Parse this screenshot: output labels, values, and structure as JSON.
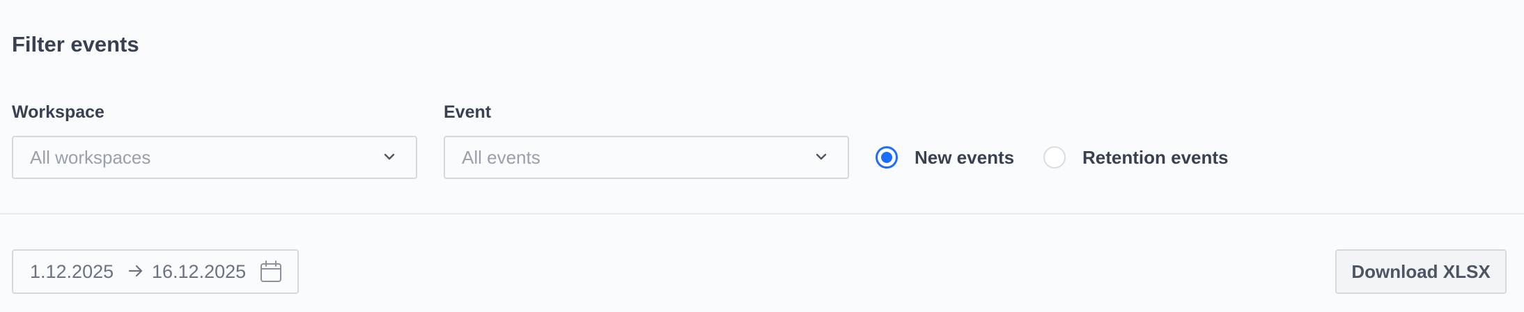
{
  "filter": {
    "title": "Filter events",
    "workspace": {
      "label": "Workspace",
      "placeholder": "All workspaces"
    },
    "event": {
      "label": "Event",
      "placeholder": "All events"
    },
    "event_type": {
      "options": [
        {
          "label": "New events",
          "selected": true
        },
        {
          "label": "Retention events",
          "selected": false
        }
      ]
    }
  },
  "toolbar": {
    "date_range": {
      "start": "1.12.2025",
      "end": "16.12.2025"
    },
    "download_label": "Download XLSX"
  },
  "colors": {
    "accent": "#1a6dff",
    "text": "#374151",
    "placeholder": "#9aa1ab",
    "border": "#d5d9de",
    "background": "#fafbfc"
  },
  "icons": {
    "select_chevron": "chevron-down-icon",
    "range_separator": "arrow-right-icon",
    "date_picker": "calendar-icon"
  }
}
